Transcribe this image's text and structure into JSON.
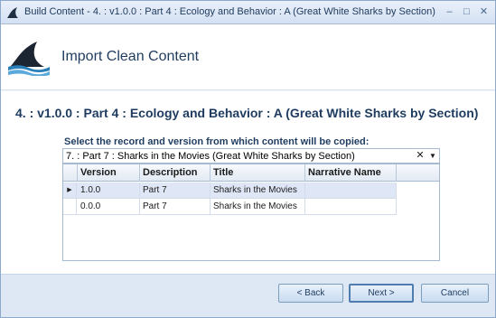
{
  "window": {
    "title": "Build Content - 4. : v1.0.0 : Part 4 : Ecology and Behavior : A (Great White Sharks by Section)",
    "controls": {
      "minimize": "–",
      "maximize": "□",
      "close": "✕"
    }
  },
  "header": {
    "title": "Import Clean Content",
    "logo_icon": "shark-fin-icon"
  },
  "record_heading": "4. : v1.0.0 : Part 4 : Ecology and Behavior : A (Great White Sharks by Section)",
  "select_label": "Select the record and version from which content will be copied:",
  "record_combo": {
    "value": "7. : Part 7 : Sharks in the Movies (Great White Sharks by Section)",
    "clear_glyph": "✕",
    "arrow_glyph": "▼"
  },
  "grid": {
    "columns": [
      "Version",
      "Description",
      "Title",
      "Narrative Name"
    ],
    "rows": [
      {
        "version": "1.0.0",
        "description": "Part 7",
        "title": "Sharks in the Movies",
        "narrative_name": "",
        "current": true
      },
      {
        "version": "0.0.0",
        "description": "Part 7",
        "title": "Sharks in the Movies",
        "narrative_name": "",
        "current": false
      }
    ],
    "current_row_glyph": "▶"
  },
  "buttons": {
    "back": "< Back",
    "next": "Next >",
    "cancel": "Cancel"
  },
  "colors": {
    "accent": "#1e3b5f",
    "window_bg": "#dee8f5",
    "selected_row": "#dfe7f6"
  }
}
